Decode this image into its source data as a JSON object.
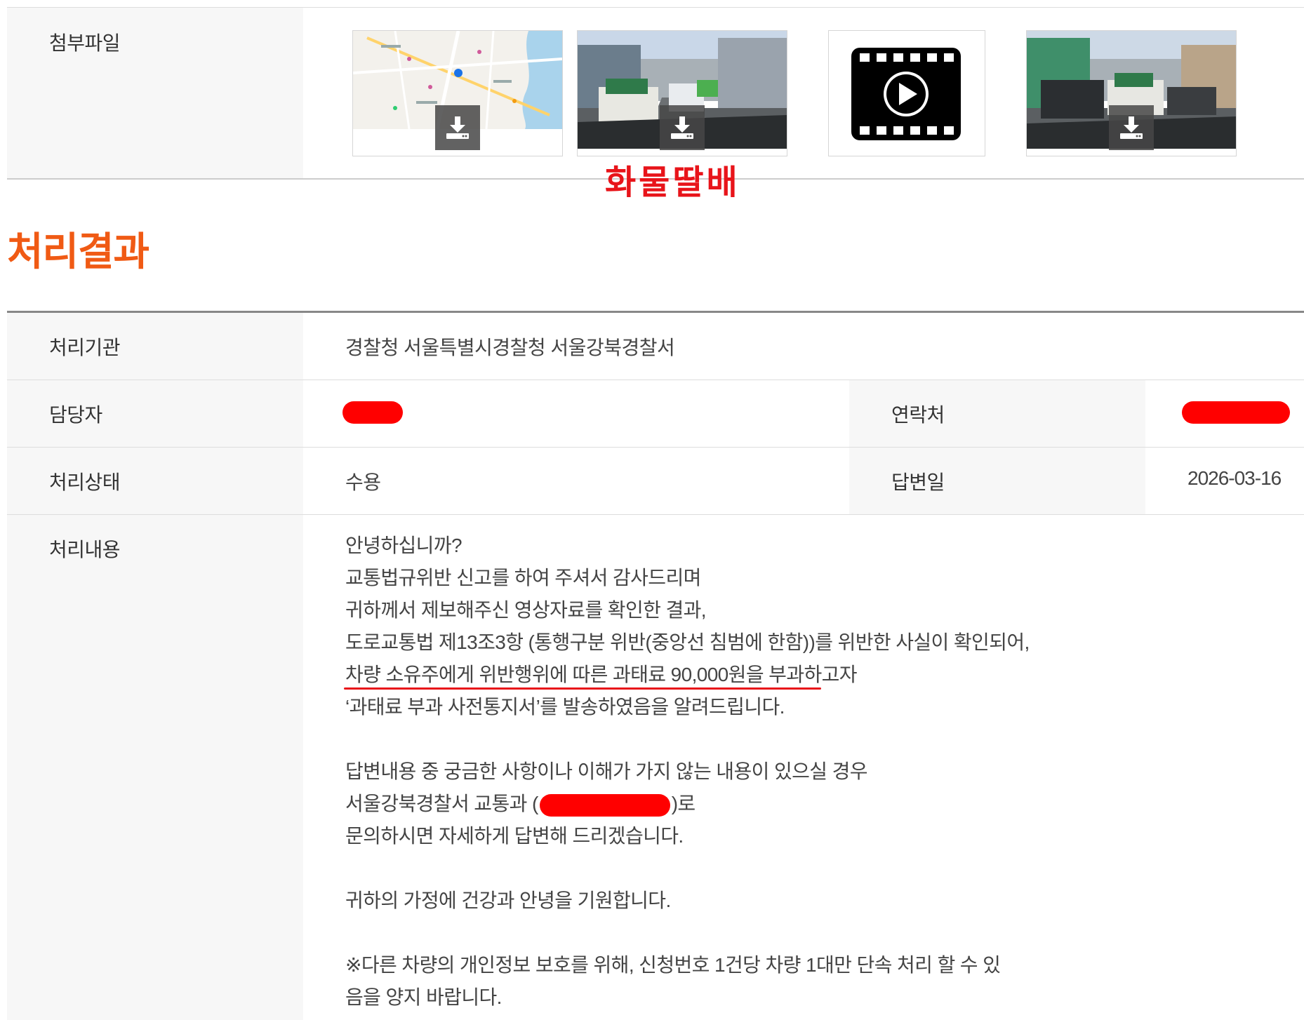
{
  "attachments": {
    "label": "첨부파일",
    "items": [
      {
        "kind": "map",
        "icon": "download-icon"
      },
      {
        "kind": "photo",
        "icon": "download-icon"
      },
      {
        "kind": "video",
        "icon": "play-video-icon"
      },
      {
        "kind": "photo",
        "icon": "download-icon"
      }
    ],
    "overlay_text": "화물딸배"
  },
  "result_section": {
    "title": "처리결과",
    "agency_label": "처리기관",
    "agency_value": "경찰청 서울특별시경찰청 서울강북경찰서",
    "officer_label": "담당자",
    "contact_label": "연락처",
    "status_label": "처리상태",
    "status_value": "수용",
    "answer_date_label": "답변일",
    "answer_date_value": "2026-03-16",
    "content_label": "처리내용",
    "content_lines": [
      "안녕하십니까?",
      "교통법규위반 신고를 하여 주셔서 감사드리며",
      "귀하께서 제보해주신 영상자료를 확인한 결과,",
      "도로교통법 제13조3항 (통행구분 위반(중앙선 침범에 한함))를 위반한 사실이 확인되어,",
      "차량 소유주에게 위반행위에 따른 과태료 90,000원을 부과하고자",
      "‘과태료 부과 사전통지서’를 발송하였음을 알려드립니다.",
      "",
      "답변내용 중 궁금한 사항이나 이해가 가지 않는 내용이 있으실 경우",
      "서울강북경찰서 교통과 (",
      "문의하시면 자세하게 답변해 드리겠습니다.",
      "",
      "귀하의 가정에 건강과 안녕을 기원합니다.",
      "",
      "※다른 차량의 개인정보 보호를 위해, 신청번호 1건당 차량 1대만 단속 처리 할 수 있",
      "음을 양지 바랍니다."
    ],
    "contact_suffix": ")로"
  },
  "colors": {
    "accent_orange": "#f05a14",
    "redaction_red": "#ff0000",
    "annotation_red": "#e8141a",
    "label_bg": "#f7f7f7"
  }
}
